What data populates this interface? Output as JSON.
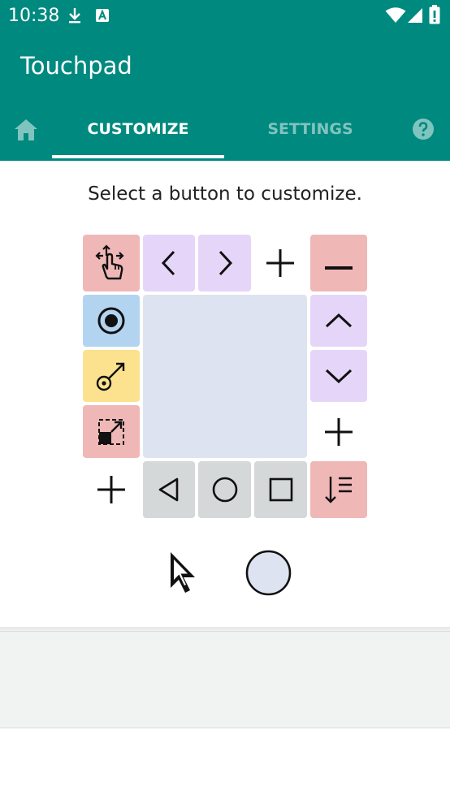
{
  "status_bar": {
    "time": "10:38",
    "icons": [
      "download-icon",
      "a-box-icon",
      "wifi-icon",
      "signal-icon",
      "battery-icon"
    ]
  },
  "app": {
    "title": "Touchpad"
  },
  "tabs": {
    "home_icon": "home-icon",
    "customize": "CUSTOMIZE",
    "settings": "SETTINGS",
    "help_icon": "help-icon",
    "selected": "customize"
  },
  "main": {
    "instruction": "Select a button to customize."
  },
  "grid": {
    "buttons": [
      {
        "name": "move-button",
        "icon": "move-hand-icon",
        "color": "#f0b7b7"
      },
      {
        "name": "left-arrow-button",
        "icon": "chevron-left-icon",
        "color": "#e5d6f9"
      },
      {
        "name": "right-arrow-button",
        "icon": "chevron-right-icon",
        "color": "#e5d6f9"
      },
      {
        "name": "add-button-top",
        "icon": "plus-icon",
        "color": ""
      },
      {
        "name": "minus-button",
        "icon": "minus-icon",
        "color": "#f0b7b7"
      },
      {
        "name": "radio-button",
        "icon": "radio-icon",
        "color": "#b3d4f0"
      },
      {
        "name": "up-arrow-button",
        "icon": "chevron-up-icon",
        "color": "#e5d6f9"
      },
      {
        "name": "key-button",
        "icon": "key-icon",
        "color": "#fce28f"
      },
      {
        "name": "down-arrow-button",
        "icon": "chevron-down-icon",
        "color": "#e5d6f9"
      },
      {
        "name": "resize-button",
        "icon": "resize-icon",
        "color": "#f0b7b7"
      },
      {
        "name": "add-button-right",
        "icon": "plus-icon",
        "color": ""
      },
      {
        "name": "add-button-bottom",
        "icon": "plus-icon",
        "color": ""
      },
      {
        "name": "back-button",
        "icon": "triangle-back-icon",
        "color": "#d4d8d8"
      },
      {
        "name": "home-nav-button",
        "icon": "circle-home-icon",
        "color": "#d4d8d8"
      },
      {
        "name": "recents-button",
        "icon": "square-recents-icon",
        "color": "#d4d8d8"
      },
      {
        "name": "sort-button",
        "icon": "sort-descending-icon",
        "color": "#f0b7b7"
      }
    ]
  },
  "pointer_options": [
    "cursor-arrow-icon",
    "circle-pointer-icon"
  ]
}
